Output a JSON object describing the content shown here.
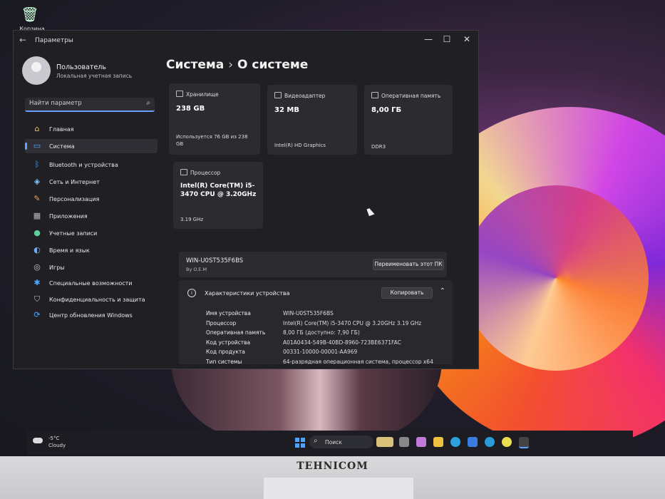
{
  "desktop": {
    "recycle_label": "Корзина"
  },
  "window": {
    "title": "Параметры",
    "controls": {
      "minimize": "—",
      "maximize": "☐",
      "close": "✕"
    }
  },
  "account": {
    "name": "Пользователь",
    "type": "Локальная учетная запись"
  },
  "search": {
    "placeholder": "Найти параметр"
  },
  "nav": [
    {
      "label": "Главная",
      "icon": "home-icon"
    },
    {
      "label": "Система",
      "icon": "system-icon",
      "active": true
    },
    {
      "label": "Bluetooth и устройства",
      "icon": "bluetooth-icon"
    },
    {
      "label": "Сеть и Интернет",
      "icon": "network-icon"
    },
    {
      "label": "Персонализация",
      "icon": "brush-icon"
    },
    {
      "label": "Приложения",
      "icon": "apps-icon"
    },
    {
      "label": "Учетные записи",
      "icon": "accounts-icon"
    },
    {
      "label": "Время и язык",
      "icon": "globe-icon"
    },
    {
      "label": "Игры",
      "icon": "gamepad-icon"
    },
    {
      "label": "Специальные возможности",
      "icon": "accessibility-icon"
    },
    {
      "label": "Конфиденциальность и защита",
      "icon": "shield-icon"
    },
    {
      "label": "Центр обновления Windows",
      "icon": "update-icon"
    }
  ],
  "breadcrumb": {
    "parent": "Система",
    "separator": "›",
    "current": "О системе"
  },
  "cards": {
    "storage": {
      "title": "Хранилище",
      "value": "238 GB",
      "sub": "Используется 76 GB из 238 GB"
    },
    "gpu": {
      "title": "Видеоадаптер",
      "value": "32 MB",
      "sub": "Intel(R) HD Graphics"
    },
    "ram": {
      "title": "Оперативная память",
      "value": "8,00 ГБ",
      "sub": "DDR3"
    },
    "cpu": {
      "title": "Процессор",
      "value": "Intel(R) Core(TM) i5-3470 CPU @ 3.20GHz",
      "sub": "3.19 GHz"
    }
  },
  "device": {
    "name": "WIN-U0ST535F6BS",
    "oem": "By O.E.M",
    "rename_label": "Переименовать этот ПК"
  },
  "specs": {
    "title": "Характеристики устройства",
    "copy_label": "Копировать",
    "rows": [
      {
        "key": "Имя устройства",
        "value": "WIN-U0ST535F6BS"
      },
      {
        "key": "Процессор",
        "value": "Intel(R) Core(TM) i5-3470 CPU @ 3.20GHz   3.19 GHz"
      },
      {
        "key": "Оперативная память",
        "value": "8,00 ГБ (доступно: 7,90 ГБ)"
      },
      {
        "key": "Код устройства",
        "value": "A01A0434-549B-40BD-8960-723BE6371FAC"
      },
      {
        "key": "Код продукта",
        "value": "00331-10000-00001-AA969"
      },
      {
        "key": "Тип системы",
        "value": "64-разрядная операционная система, процессор x64"
      }
    ]
  },
  "taskbar": {
    "temperature": "-5°C",
    "condition": "Cloudy",
    "search_label": "Поиск"
  },
  "monitor": {
    "brand": "TEHNICOM"
  },
  "colors": {
    "accent": "#5aa7ff",
    "window_bg": "#202024",
    "card_bg": "#2b2b30"
  }
}
